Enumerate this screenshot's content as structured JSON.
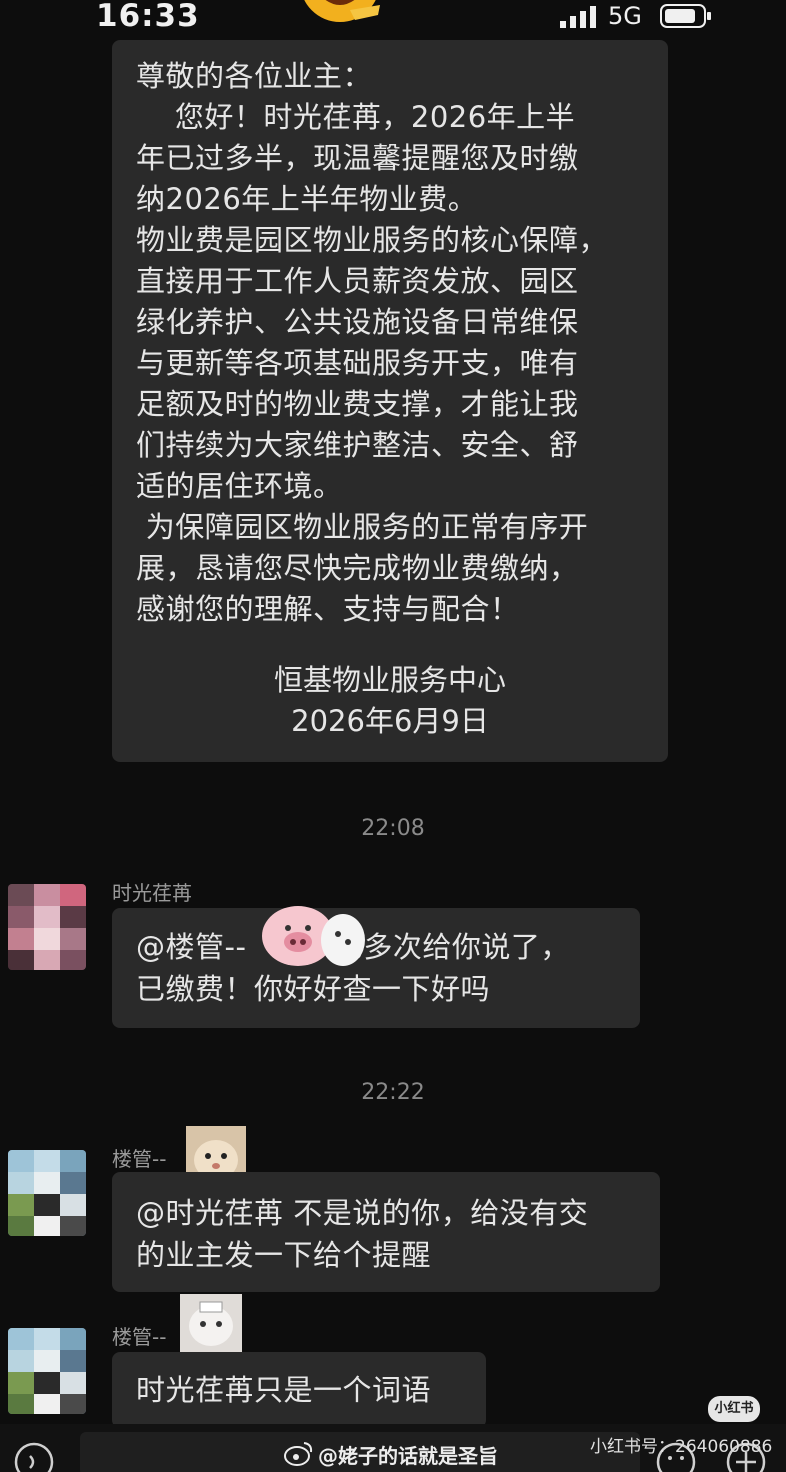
{
  "status_bar": {
    "time": "16:33",
    "network": "5G",
    "icons": [
      "laughing-emoji-icon",
      "signal-icon",
      "battery-icon"
    ]
  },
  "notice": {
    "lines": [
      "尊敬的各位业主：",
      "    您好！时光荏苒，2026年上半",
      "年已过多半，现温馨提醒您及时缴",
      "纳2026年上半年物业费。",
      "物业费是园区物业服务的核心保障，",
      "直接用于工作人员薪资发放、园区",
      "绿化养护、公共设施设备日常维保",
      "与更新等各项基础服务开支，唯有",
      "足额及时的物业费支撑，才能让我",
      "们持续为大家维护整洁、安全、舒",
      "适的居住环境。",
      " 为保障园区物业服务的正常有序开",
      "展，恳请您尽快完成物业费缴纳，",
      "感谢您的理解、支持与配合！"
    ],
    "signature": "恒基物业服务中心",
    "date": "2026年6月9日"
  },
  "messages": [
    {
      "timestamp": "22:08",
      "sender": "时光荏苒",
      "text_lines": [
        "@楼管--         已多次给你说了，",
        "已缴费！你好好查一下好吗"
      ]
    },
    {
      "timestamp": "22:22",
      "sender": "楼管--",
      "text_lines": [
        "@时光荏苒 不是说的你，给没有交",
        "的业主发一下给个提醒"
      ]
    },
    {
      "sender": "楼管--",
      "text_lines": [
        "时光荏苒只是一个词语"
      ]
    }
  ],
  "watermarks": {
    "badge": "小红书",
    "account_id": "小红书号：264060886",
    "weibo": "@姥子的话就是圣旨"
  },
  "colors": {
    "background": "#0d0d0d",
    "bubble": "#2a2a2a",
    "text": "#e6e6e6",
    "muted": "#8a8a8a"
  }
}
